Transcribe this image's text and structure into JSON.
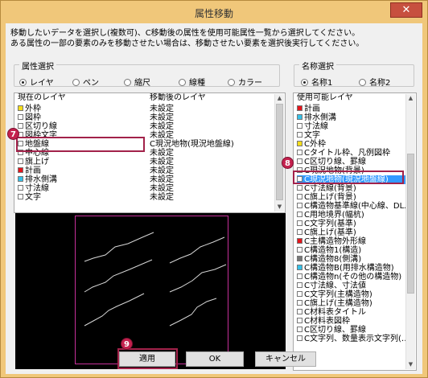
{
  "window": {
    "title": "属性移動",
    "close_glyph": "✕"
  },
  "messages": [
    "移動したいデータを選択し(複数可)、C移動後の属性を使用可能属性一覧から選択してください。",
    "ある属性の一部の要素のみを移動させたい場合は、移動させたい要素を選択後実行してください。"
  ],
  "attribute_group": {
    "label": "属性選択",
    "options": [
      {
        "label": "レイヤ",
        "checked": true
      },
      {
        "label": "ペン",
        "checked": false
      },
      {
        "label": "縮尺",
        "checked": false
      },
      {
        "label": "線種",
        "checked": false
      },
      {
        "label": "カラー",
        "checked": false
      }
    ]
  },
  "name_group": {
    "label": "名称選択",
    "options": [
      {
        "label": "名称1",
        "checked": true
      },
      {
        "label": "名称2",
        "checked": false
      }
    ]
  },
  "current_list": {
    "col_current": "現在のレイヤ",
    "col_after": "移動後のレイヤ",
    "rows": [
      {
        "color": "#f5dd1a",
        "name": "外枠",
        "after": "未設定"
      },
      {
        "color": "#ffffff",
        "name": "図枠",
        "after": "未設定"
      },
      {
        "color": "#ffffff",
        "name": "区切り線",
        "after": "未設定"
      },
      {
        "color": "#ffffff",
        "name": "図枠文字",
        "after": "未設定"
      },
      {
        "color": "#ffffff",
        "name": "地盤線",
        "after": "C現況地物(現況地盤線)"
      },
      {
        "color": "#ffffff",
        "name": "中心線",
        "after": "未設定"
      },
      {
        "color": "#ffffff",
        "name": "旗上げ",
        "after": "未設定"
      },
      {
        "color": "#e5141b",
        "name": "計画",
        "after": "未設定"
      },
      {
        "color": "#35c1e8",
        "name": "排水側溝",
        "after": "未設定"
      },
      {
        "color": "#ffffff",
        "name": "寸法線",
        "after": "未設定"
      },
      {
        "color": "#ffffff",
        "name": "文字",
        "after": "未設定"
      }
    ]
  },
  "available_list": {
    "header": "使用可能レイヤ",
    "rows": [
      {
        "color": "#e5141b",
        "name": "計画"
      },
      {
        "color": "#35c1e8",
        "name": "排水側溝"
      },
      {
        "color": "#ffffff",
        "name": "寸法線"
      },
      {
        "color": "#ffffff",
        "name": "文字"
      },
      {
        "color": "#f5dd1a",
        "name": "C外枠"
      },
      {
        "color": "#ffffff",
        "name": "Cタイトル枠、凡例図枠"
      },
      {
        "color": "#ffffff",
        "name": "C区切り線、罫線"
      },
      {
        "color": "#ffffff",
        "name": "C現況地物(背景)"
      },
      {
        "color": "#ffffff",
        "name": "C現況地物(現況地盤線)"
      },
      {
        "color": "#ffffff",
        "name": "C寸法線(背景)"
      },
      {
        "color": "#ffffff",
        "name": "C旗上げ(背景)"
      },
      {
        "color": "#ffffff",
        "name": "C構造物基準線(中心線、DL..."
      },
      {
        "color": "#ffffff",
        "name": "C用地境界(幅杭)"
      },
      {
        "color": "#ffffff",
        "name": "C文字列(基準)"
      },
      {
        "color": "#ffffff",
        "name": "C旗上げ(基準)"
      },
      {
        "color": "#e5141b",
        "name": "C主構造物外形線"
      },
      {
        "color": "#ffffff",
        "name": "C構造物1(構造)"
      },
      {
        "color": "#777777",
        "name": "C構造物8(側溝)"
      },
      {
        "color": "#35c1e8",
        "name": "C構造物B(用排水構造物)"
      },
      {
        "color": "#ffffff",
        "name": "C構造物n(その他の構造物)"
      },
      {
        "color": "#ffffff",
        "name": "C寸法線、寸法値"
      },
      {
        "color": "#ffffff",
        "name": "C文字列(主構造物)"
      },
      {
        "color": "#ffffff",
        "name": "C旗上げ(主構造物)"
      },
      {
        "color": "#ffffff",
        "name": "C材料表タイトル"
      },
      {
        "color": "#ffffff",
        "name": "C材料表図枠"
      },
      {
        "color": "#ffffff",
        "name": "C区切り線、罫線"
      },
      {
        "color": "#ffffff",
        "name": "C文字列、数量表示文字列(…"
      }
    ]
  },
  "buttons": {
    "apply": "適用",
    "ok": "OK",
    "cancel": "キャンセル"
  },
  "markers": {
    "m7": "7",
    "m8": "8",
    "m9": "9"
  },
  "accent": {
    "callout": "#a2224a",
    "selection": "#3399ff",
    "preview_frame": "#c6309a"
  }
}
